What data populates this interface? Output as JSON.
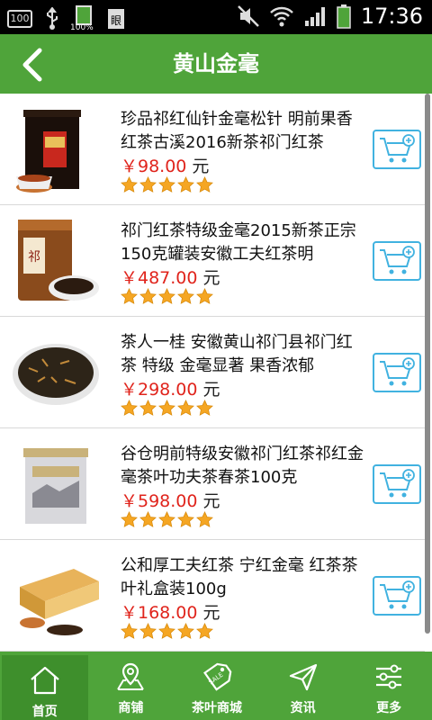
{
  "status_bar": {
    "battery_left": "100",
    "battery_main": "100%",
    "time": "17:36"
  },
  "header": {
    "title": "黄山金毫",
    "back_icon": "chevron-left-icon"
  },
  "colors": {
    "brand_green": "#4fa43a",
    "active_tab": "#3e8f2c",
    "price_red": "#e0241c",
    "cart_blue": "#41b2e0",
    "star_gold": "#f5a623"
  },
  "products": [
    {
      "name": "珍品祁红仙针金毫松针 明前果香红茶古溪2016新茶祁门红茶",
      "price": "￥98.00",
      "unit": "元",
      "rating": 5
    },
    {
      "name": "祁门红茶特级金毫2015新茶正宗150克罐装安徽工夫红茶明",
      "price": "￥487.00",
      "unit": "元",
      "rating": 5
    },
    {
      "name": "茶人一桂 安徽黄山祁门县祁门红茶 特级 金毫显著 果香浓郁",
      "price": "￥298.00",
      "unit": "元",
      "rating": 5
    },
    {
      "name": "谷仓明前特级安徽祁门红茶祁红金毫茶叶功夫茶春茶100克",
      "price": "￥598.00",
      "unit": "元",
      "rating": 5
    },
    {
      "name": "公和厚工夫红茶 宁红金毫 红茶茶叶礼盒装100g",
      "price": "￥168.00",
      "unit": "元",
      "rating": 5
    }
  ],
  "nav": [
    {
      "label": "首页",
      "icon": "home-icon",
      "active": true
    },
    {
      "label": "商铺",
      "icon": "map-pin-icon",
      "active": false
    },
    {
      "label": "茶叶商城",
      "icon": "sale-tag-icon",
      "active": false
    },
    {
      "label": "资讯",
      "icon": "send-icon",
      "active": false
    },
    {
      "label": "更多",
      "icon": "sliders-icon",
      "active": false
    }
  ]
}
